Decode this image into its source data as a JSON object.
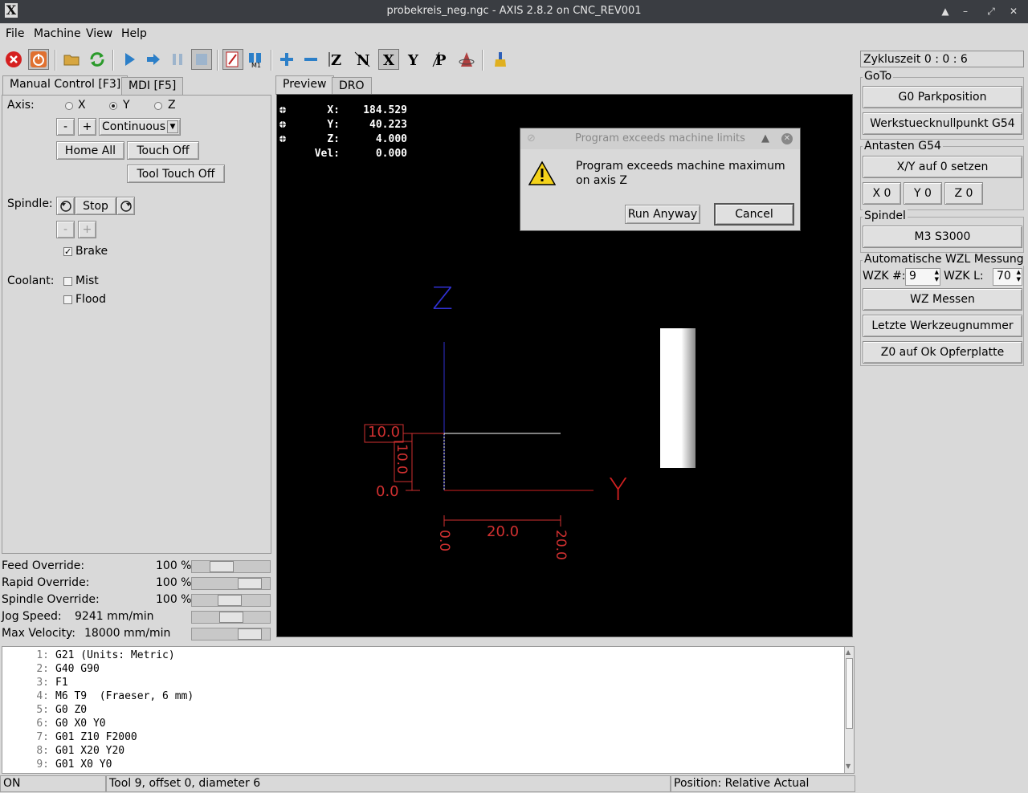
{
  "window": {
    "title": "probekreis_neg.ngc - AXIS 2.8.2 on CNC_REV001"
  },
  "menu": [
    "File",
    "Machine",
    "View",
    "Help"
  ],
  "tabs_left": [
    "Manual Control [F3]",
    "MDI [F5]"
  ],
  "tabs_view": [
    "Preview",
    "DRO"
  ],
  "manual": {
    "axis_label": "Axis:",
    "axes": [
      "X",
      "Y",
      "Z"
    ],
    "selected_axis": "Y",
    "minus": "-",
    "plus": "+",
    "jog_mode": "Continuous",
    "home_all": "Home All",
    "touch_off": "Touch Off",
    "tool_touch_off": "Tool Touch Off",
    "spindle_label": "Spindle:",
    "stop": "Stop",
    "spindle_minus": "-",
    "spindle_plus": "+",
    "brake": "Brake",
    "brake_checked": true,
    "coolant_label": "Coolant:",
    "mist": "Mist",
    "flood": "Flood"
  },
  "overrides": [
    {
      "label": "Feed Override:",
      "value": "100 %",
      "level": 0.33
    },
    {
      "label": "Rapid Override:",
      "value": "100 %",
      "level": 0.85
    },
    {
      "label": "Spindle Override:",
      "value": "100 %",
      "level": 0.48
    },
    {
      "label": "Jog Speed:",
      "value": "9241 mm/min",
      "level": 0.5
    },
    {
      "label": "Max Velocity:",
      "value": "18000 mm/min",
      "level": 0.85
    }
  ],
  "dro": [
    {
      "label": "X:",
      "value": "184.529"
    },
    {
      "label": "Y:",
      "value": "40.223"
    },
    {
      "label": "Z:",
      "value": "4.000"
    },
    {
      "label": "Vel:",
      "value": "0.000"
    }
  ],
  "preview": {
    "axis_z": "Z",
    "axis_y": "Y",
    "dim_10_box": "10.0",
    "dim_10_vert": "10.0",
    "dim_0": "0.0",
    "dim_20": "20.0",
    "dim_0_rot": "0.0",
    "dim_20_rot": "20.0"
  },
  "dialog": {
    "title": "Program exceeds machine limits",
    "message": "Program exceeds machine maximum on axis Z",
    "run_anyway": "Run Anyway",
    "cancel": "Cancel"
  },
  "code": [
    {
      "n": "1:",
      "t": "G21 (Units: Metric)"
    },
    {
      "n": "2:",
      "t": "G40 G90"
    },
    {
      "n": "3:",
      "t": "F1"
    },
    {
      "n": "4:",
      "t": "M6 T9  (Fraeser, 6 mm)"
    },
    {
      "n": "5:",
      "t": "G0 Z0"
    },
    {
      "n": "6:",
      "t": "G0 X0 Y0"
    },
    {
      "n": "7:",
      "t": "G01 Z10 F2000"
    },
    {
      "n": "8:",
      "t": "G01 X20 Y20"
    },
    {
      "n": "9:",
      "t": "G01 X0 Y0"
    }
  ],
  "status": {
    "state": "ON",
    "tool": "Tool 9, offset 0, diameter 6",
    "position": "Position: Relative Actual"
  },
  "right": {
    "cycle_time": "Zykluszeit  0 :  0 :  6",
    "goto_label": "GoTo",
    "g0_park": "G0 Parkposition",
    "werkstueck": "Werkstuecknullpunkt G54",
    "antasten_label": "Antasten G54",
    "xy_zero": "X/Y auf 0 setzen",
    "x0": "X 0",
    "y0": "Y 0",
    "z0": "Z 0",
    "spindel_label": "Spindel",
    "m3": "M3 S3000",
    "wzl_label": "Automatische WZL Messung",
    "wzk_num_label": "WZK #:",
    "wzk_num": "9",
    "wzk_l_label": "WZK   L:",
    "wzk_l": "70",
    "wz_messen": "WZ Messen",
    "letzte": "Letzte Werkzeugnummer",
    "z0_ok": "Z0 auf Ok Opferplatte"
  }
}
